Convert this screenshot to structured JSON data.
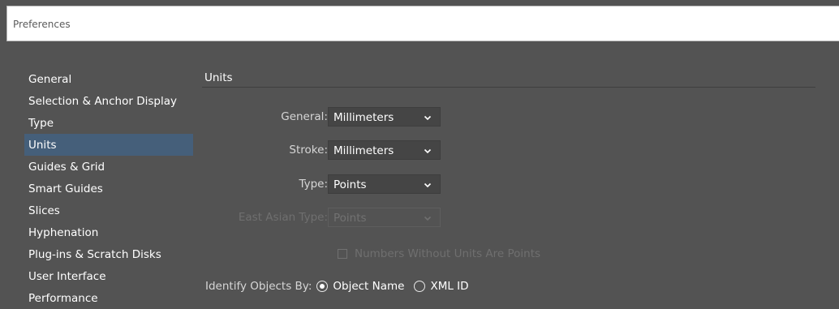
{
  "window": {
    "title": "Preferences"
  },
  "nav": {
    "items": [
      {
        "label": "General",
        "selected": false
      },
      {
        "label": "Selection & Anchor Display",
        "selected": false
      },
      {
        "label": "Type",
        "selected": false
      },
      {
        "label": "Units",
        "selected": true
      },
      {
        "label": "Guides & Grid",
        "selected": false
      },
      {
        "label": "Smart Guides",
        "selected": false
      },
      {
        "label": "Slices",
        "selected": false
      },
      {
        "label": "Hyphenation",
        "selected": false
      },
      {
        "label": "Plug-ins & Scratch Disks",
        "selected": false
      },
      {
        "label": "User Interface",
        "selected": false
      },
      {
        "label": "Performance",
        "selected": false
      }
    ]
  },
  "units": {
    "section_title": "Units",
    "general": {
      "label": "General:",
      "value": "Millimeters"
    },
    "stroke": {
      "label": "Stroke:",
      "value": "Millimeters"
    },
    "type": {
      "label": "Type:",
      "value": "Points"
    },
    "east_asian_type": {
      "label": "East Asian Type:",
      "value": "Points",
      "disabled": true
    },
    "numbers_without_units": {
      "label": "Numbers Without Units Are Points",
      "checked": false,
      "disabled": true
    },
    "identify_objects": {
      "label": "Identify Objects By:",
      "options": [
        {
          "label": "Object Name",
          "selected": true
        },
        {
          "label": "XML ID",
          "selected": false
        }
      ]
    }
  },
  "colors": {
    "background": "#535353",
    "selected_item": "#455f7a",
    "dropdown": "#454545"
  },
  "icons": {
    "dropdown": "chevron-down-icon",
    "radio": "radio-icon",
    "checkbox": "checkbox-icon"
  }
}
